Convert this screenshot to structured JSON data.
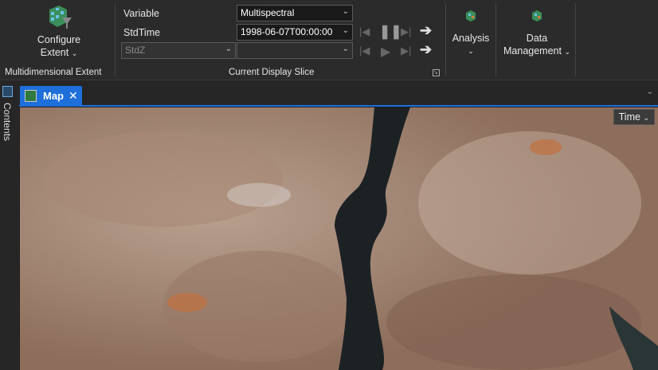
{
  "ribbon": {
    "configure_extent": {
      "label_line1": "Configure",
      "label_line2": "Extent",
      "group": "Multidimensional Extent"
    },
    "slice": {
      "variable_label": "Variable",
      "stdtime_label": "StdTime",
      "variable_value": "Multispectral",
      "stdtime_value": "1998-06-07T00:00:00",
      "stdz_placeholder": "StdZ",
      "stdz_value": "",
      "group": "Current Display Slice"
    },
    "analysis": {
      "label": "Analysis"
    },
    "data_management": {
      "label_line1": "Data",
      "label_line2": "Management"
    }
  },
  "tabs": [
    {
      "label": "Map",
      "active": true
    }
  ],
  "sidebar": {
    "contents_label": "Contents"
  },
  "map": {
    "time_button": "Time"
  },
  "colors": {
    "accent": "#1e6fd9",
    "ribbon_bg": "#2b2b2b"
  }
}
